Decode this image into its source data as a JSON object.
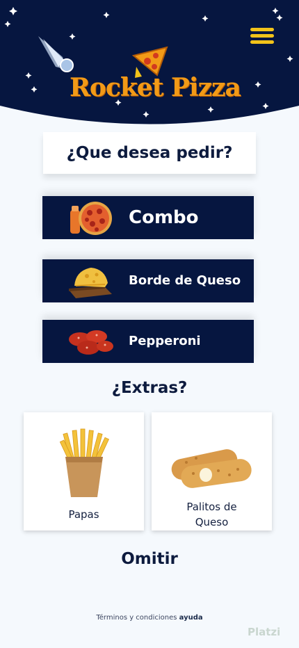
{
  "header": {
    "brand": "Rocket Pizza",
    "menu_icon": "hamburger-menu-icon",
    "colors": {
      "sky": "#061640",
      "brand": "#f29a17",
      "menu": "#f2c31a"
    }
  },
  "question": "¿Que desea pedir?",
  "options": [
    {
      "label": "Combo",
      "icon": "pizza-combo-image"
    },
    {
      "label": "Borde de Queso",
      "icon": "cheese-board-image"
    },
    {
      "label": "Pepperoni",
      "icon": "pepperoni-image"
    }
  ],
  "extras": {
    "title": "¿Extras?",
    "items": [
      {
        "name": "Papas",
        "icon": "fries-image"
      },
      {
        "name_line1": "Palitos de",
        "name_line2": "Queso",
        "icon": "cheese-sticks-image"
      }
    ]
  },
  "skip_label": "Omitir",
  "footer": {
    "terms": "Términos y condiciones",
    "help": "ayuda"
  },
  "watermark": "Platzi"
}
